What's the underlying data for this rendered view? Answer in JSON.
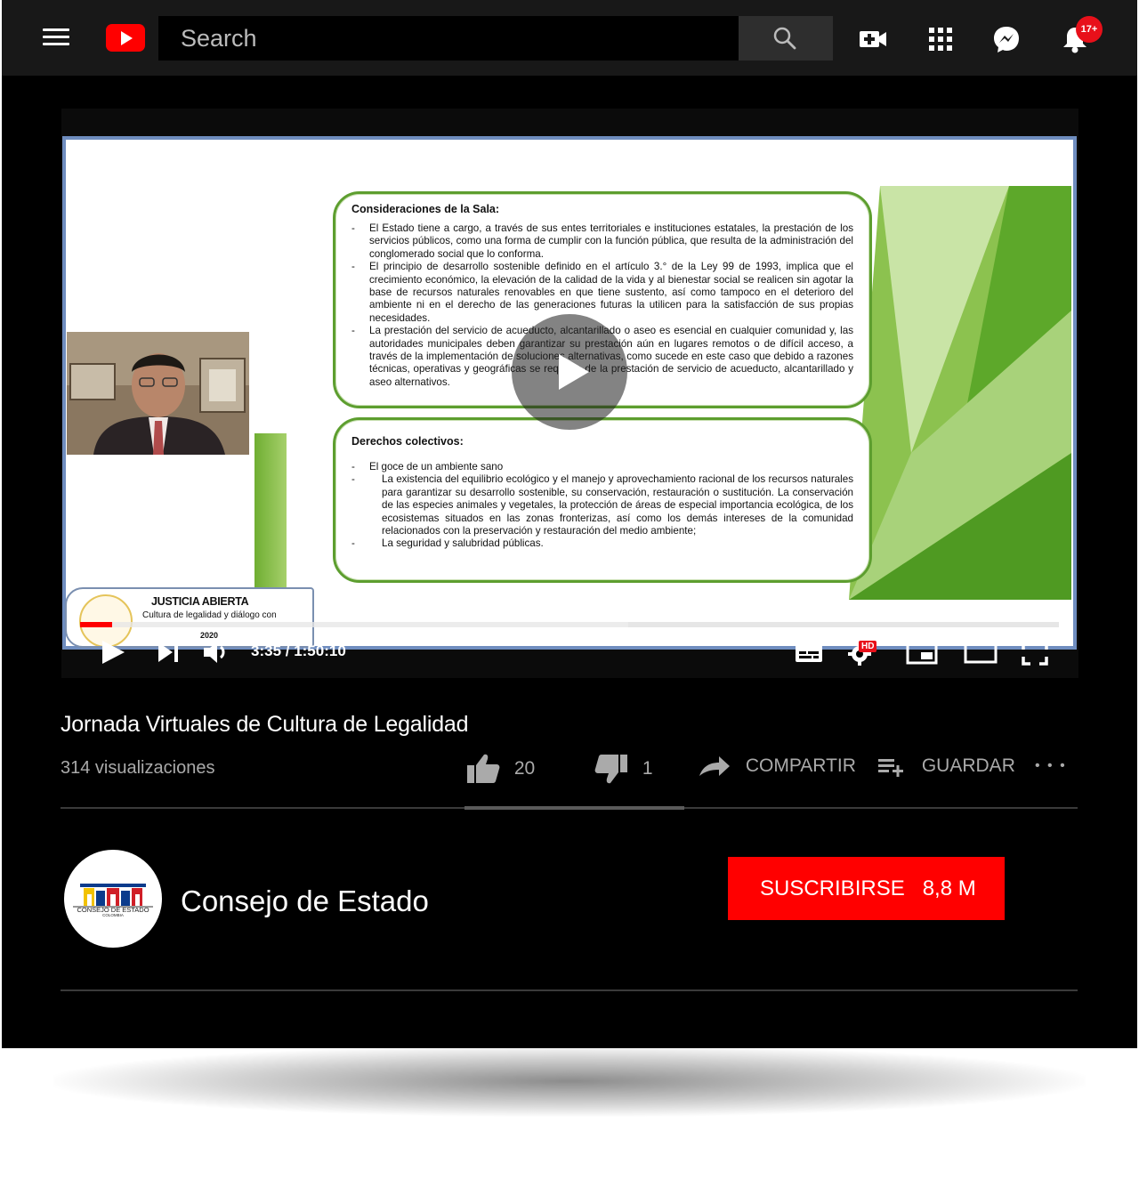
{
  "header": {
    "search_placeholder": "Search",
    "notification_count": "17+"
  },
  "slide": {
    "box1_title": "Consideraciones de la Sala:",
    "box1_items": [
      "El Estado tiene a cargo, a través de sus entes territoriales e instituciones estatales, la prestación de los servicios públicos, como una forma de cumplir con la función pública, que resulta de la administración del conglomerado social que lo conforma.",
      "El principio de desarrollo sostenible definido en el artículo 3.° de la Ley 99 de 1993, implica que el crecimiento económico, la elevación de la calidad de la vida y al bienestar social se realicen sin agotar la base de recursos naturales renovables en que tiene sustento, así como tampoco en el deterioro del ambiente ni en el derecho de las generaciones futuras la utilicen para la satisfacción de sus propias necesidades.",
      "La prestación del servicio de acueducto, alcantarillado o aseo es esencial en cualquier comunidad y, las autoridades municipales deben garantizar su prestación aún en lugares remotos o de difícil acceso, a través de la implementación de soluciones alternativas, como sucede en este caso que debido a razones técnicas, operativas y geográficas se requiere de la prestación de servicio de acueducto, alcantarillado y aseo alternativos."
    ],
    "box2_title": "Derechos colectivos:",
    "box2_item1": "El goce de un ambiente sano",
    "box2_item2": "La existencia del equilibrio ecológico y el manejo y aprovechamiento racional de los recursos naturales para garantizar su desarrollo sostenible, su conservación, restauración o sustitución. La conservación de las especies animales y vegetales, la protección de áreas de especial importancia ecológica, de los ecosistemas situados en las zonas fronterizas, así como los demás intereses de la comunidad relacionados con la preservación y restauración del medio ambiente;",
    "box2_item3": "La seguridad y salubridad públicas."
  },
  "banner": {
    "title": "JUSTICIA ABIERTA",
    "subtitle": "Cultura de legalidad y diálogo con",
    "year": "2020"
  },
  "player": {
    "time_display": "3:35 / 1:50:10",
    "progress_fraction": 0.0326,
    "buffer_fraction": 0.56,
    "hd_badge": "HD"
  },
  "video": {
    "title": "Jornada Virtuales de Cultura de Legalidad",
    "views": "314 visualizaciones",
    "likes": "20",
    "dislikes": "1",
    "share_label": "COMPARTIR",
    "save_label": "GUARDAR",
    "more_label": "• • •"
  },
  "channel": {
    "name": "Consejo de Estado",
    "logo_text": "CONSEJO DE ESTADO",
    "logo_subtext": "COLOMBIA",
    "subscribe_label": "SUSCRIBIRSE",
    "subscriber_count": "8,8 M"
  },
  "colors": {
    "accent": "#ff0000",
    "background": "#000000",
    "topbar": "#181818",
    "slide_green": "#5d9e2f"
  }
}
